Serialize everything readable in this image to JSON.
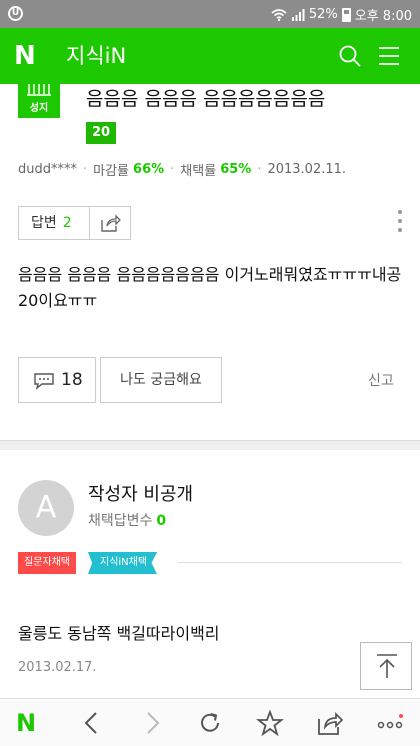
{
  "status_bar": {
    "battery": "52%",
    "clock": "오후 8:00"
  },
  "app": {
    "logo": "N",
    "title": "지식iN"
  },
  "question": {
    "badge": "성지",
    "title": "음음음 음음음 음음음음음음음",
    "points": "20",
    "author": "dudd****",
    "deadline_label": "마감률",
    "deadline_value": "66%",
    "adopt_label": "채택률",
    "adopt_value": "65%",
    "date": "2013.02.11.",
    "answer_label": "답변",
    "answer_count": "2",
    "body": "음음음 음음음 음음음음음음음 이거노래뭐였죠ㅠㅠㅠ내공20이요ㅠㅠ",
    "comment_count": "18",
    "curious_label": "나도 궁금해요",
    "report_label": "신고"
  },
  "answer": {
    "avatar_letter": "A",
    "author": "작성자 비공개",
    "adopt_label": "채택답변수",
    "adopt_count": "0",
    "tag_asker": "질문자채택",
    "tag_jisik": "지식iN채택",
    "body": "울릉도 동남쪽 백길따라이백리",
    "date": "2013.02.17."
  },
  "toolbar": {
    "home": "N"
  },
  "colors": {
    "brand_green": "#1ec800",
    "tag_red": "#ff4a4a",
    "tag_teal": "#23bfcf",
    "status_gray": "#8c8c8c"
  },
  "icons": [
    "wifi-icon",
    "signal-icon",
    "battery-icon",
    "search-icon",
    "menu-icon",
    "share-icon",
    "more-icon",
    "comment-icon",
    "arrow-up-icon",
    "back-icon",
    "forward-icon",
    "refresh-icon",
    "star-icon",
    "share-icon",
    "more-icon"
  ]
}
